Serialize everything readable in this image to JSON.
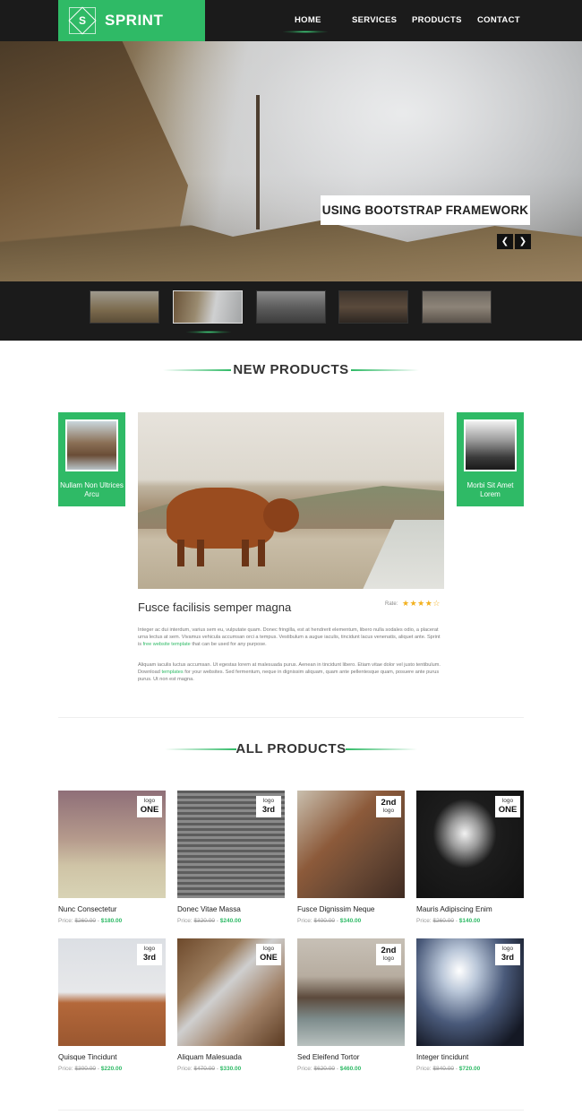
{
  "header": {
    "logo_letter": "S",
    "brand": "SPRINT",
    "nav": [
      "HOME",
      "SERVICES",
      "PRODUCTS",
      "CONTACT"
    ],
    "active_nav": "HOME"
  },
  "slider": {
    "caption": "USING BOOTSTRAP FRAMEWORK",
    "prev_icon": "chevron-left-icon",
    "next_icon": "chevron-right-icon",
    "thumbnail_count": 5,
    "active_thumbnail": 2
  },
  "new_products": {
    "heading": "NEW PRODUCTS",
    "left_card": "Nullam Non Ultrices Arcu",
    "right_card": "Morbi Sit Amet Lorem",
    "feature": {
      "title": "Fusce facilisis semper magna",
      "rating_label": "Rate:",
      "rating": 4.5,
      "para1_a": "Integer ac dui interdum, varius sem eu, vulputate quam. Donec fringilla, est at hendrerit elementum, libero nulla sodales odio, a placerat urna lectus at sem. Vivamus vehicula accumsan orci a tempus. Vestibulum a augue iaculis, tincidunt lacus venenatis, aliquet ante. Sprint is ",
      "para1_link": "free website template",
      "para1_b": " that can be used for any purpose.",
      "para2_a": "Aliquam iaculis luctus accumsan. Ut egestas lorem at malesuada purus. Aenean in tincidunt libero. Etiam vitae dolor vel justo tentibulum. Download ",
      "para2_link": "templates",
      "para2_b": " for your websites. Sed fermentum, neque in dignissim aliquam, quam ante pellentesque quam, posuere ante purus purus. Ut non est magna."
    }
  },
  "all_products": {
    "heading": "ALL PRODUCTS",
    "price_label": "Price:",
    "items": [
      {
        "name": "Nunc Consectetur",
        "badge_top": "logo",
        "badge_bottom": "ONE",
        "old": "$260.00",
        "new": "$180.00"
      },
      {
        "name": "Donec Vitae Massa",
        "badge_top": "logo",
        "badge_bottom": "3rd",
        "old": "$320.00",
        "new": "$240.00"
      },
      {
        "name": "Fusce Dignissim Neque",
        "badge_top": "2nd",
        "badge_bottom": "logo",
        "old": "$400.00",
        "new": "$340.00"
      },
      {
        "name": "Mauris Adipiscing Enim",
        "badge_top": "logo",
        "badge_bottom": "ONE",
        "old": "$260.00",
        "new": "$140.00"
      },
      {
        "name": "Quisque Tincidunt",
        "badge_top": "logo",
        "badge_bottom": "3rd",
        "old": "$300.00",
        "new": "$220.00"
      },
      {
        "name": "Aliquam Malesuada",
        "badge_top": "logo",
        "badge_bottom": "ONE",
        "old": "$470.00",
        "new": "$330.00"
      },
      {
        "name": "Sed Eleifend Tortor",
        "badge_top": "2nd",
        "badge_bottom": "logo",
        "old": "$620.00",
        "new": "$460.00"
      },
      {
        "name": "Integer tincidunt",
        "badge_top": "logo",
        "badge_bottom": "3rd",
        "old": "$840.00",
        "new": "$720.00"
      }
    ]
  }
}
